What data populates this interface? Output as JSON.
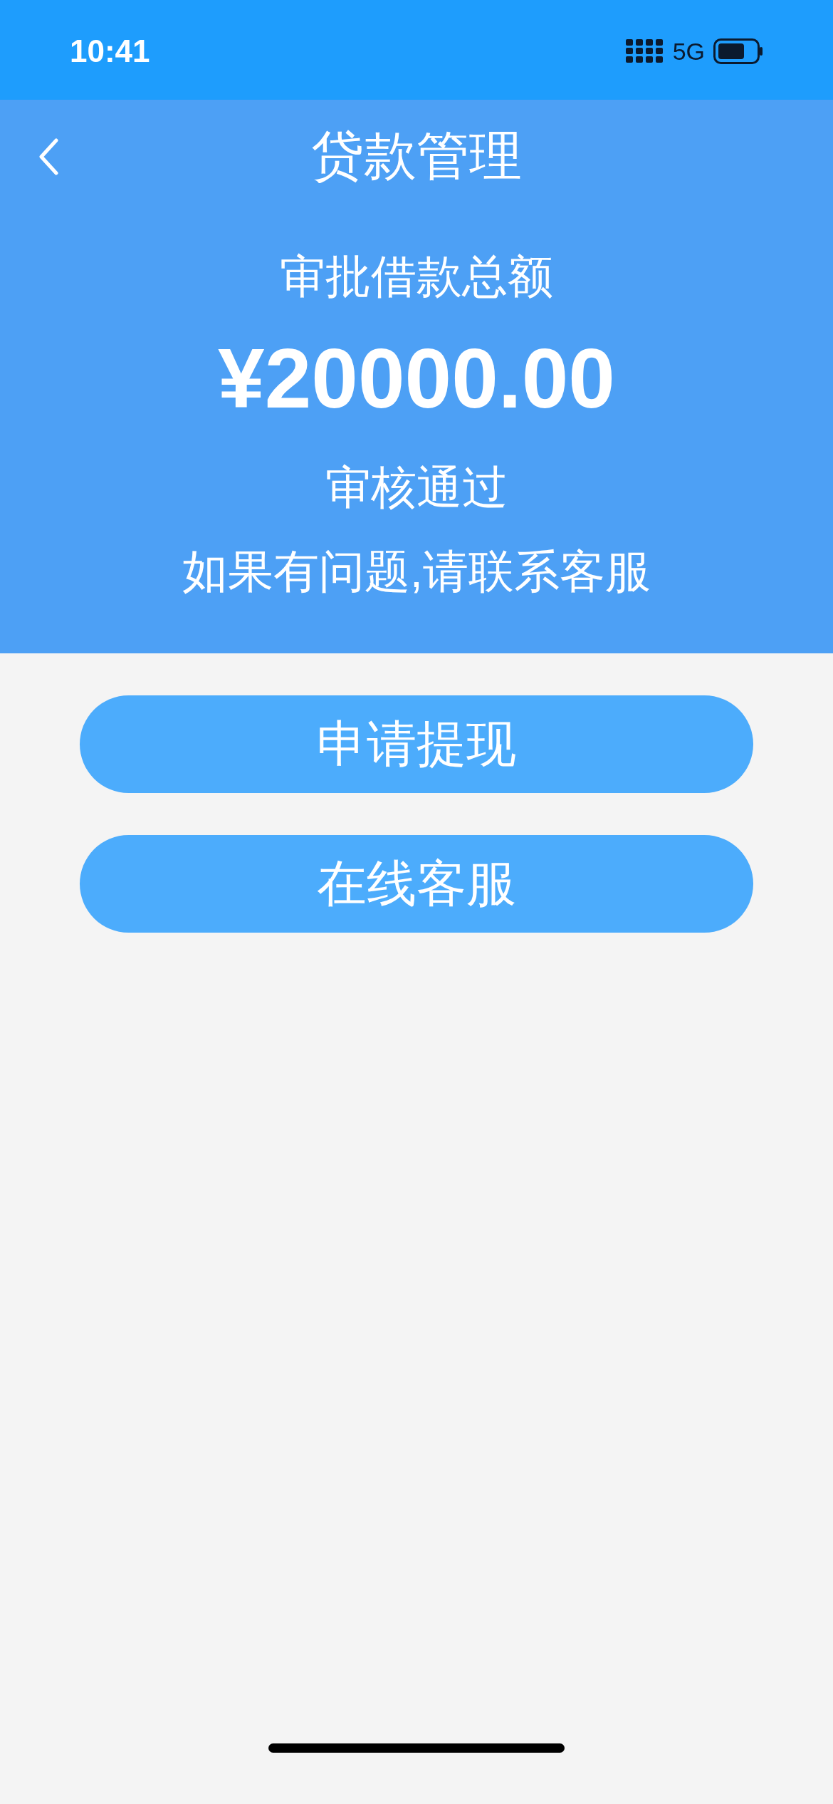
{
  "status_bar": {
    "time": "10:41",
    "network": "5G"
  },
  "nav": {
    "title": "贷款管理"
  },
  "summary": {
    "label": "审批借款总额",
    "amount": "¥20000.00",
    "status": "审核通过",
    "note": "如果有问题,请联系客服"
  },
  "buttons": [
    {
      "label": "申请提现"
    },
    {
      "label": "在线客服"
    }
  ]
}
